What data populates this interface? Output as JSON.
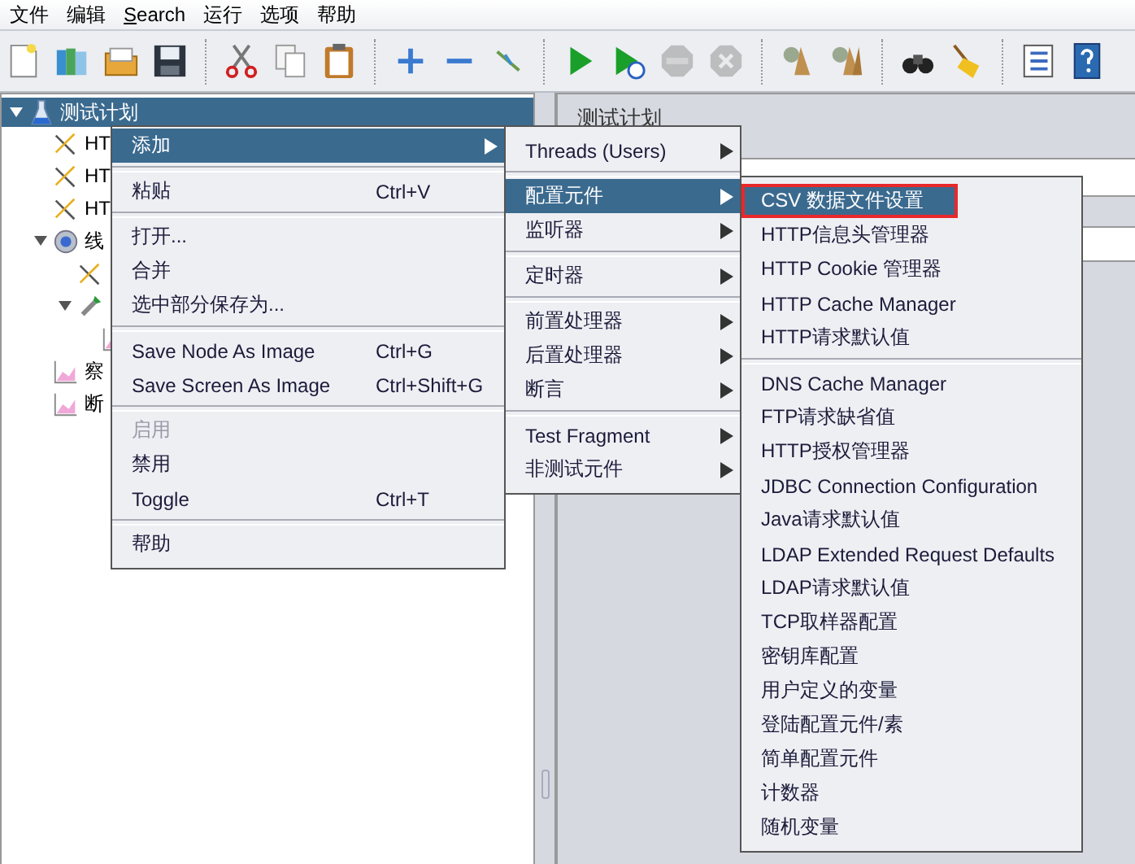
{
  "menubar": [
    {
      "label": "文件",
      "underline_first": false
    },
    {
      "label": "编辑",
      "underline_first": false
    },
    {
      "label": "Search",
      "underline_first": true
    },
    {
      "label": "运行",
      "underline_first": false
    },
    {
      "label": "选项",
      "underline_first": false
    },
    {
      "label": "帮助",
      "underline_first": false
    }
  ],
  "toolbar": [
    [
      {
        "kind": "new",
        "disabled": false
      },
      {
        "kind": "templates",
        "disabled": false
      },
      {
        "kind": "open",
        "disabled": false
      },
      {
        "kind": "save",
        "disabled": false
      }
    ],
    [
      {
        "kind": "cut",
        "disabled": false
      },
      {
        "kind": "copy",
        "disabled": false
      },
      {
        "kind": "paste",
        "disabled": false
      }
    ],
    [
      {
        "kind": "expand",
        "disabled": false
      },
      {
        "kind": "collapse",
        "disabled": false
      },
      {
        "kind": "toggle",
        "disabled": false
      }
    ],
    [
      {
        "kind": "start",
        "disabled": false
      },
      {
        "kind": "start_no_pause",
        "disabled": false
      },
      {
        "kind": "stop",
        "disabled": true
      },
      {
        "kind": "shutdown",
        "disabled": true
      }
    ],
    [
      {
        "kind": "clear",
        "disabled": false
      },
      {
        "kind": "clear_all",
        "disabled": false
      }
    ],
    [
      {
        "kind": "search",
        "disabled": false
      },
      {
        "kind": "reset_search",
        "disabled": false
      }
    ],
    [
      {
        "kind": "function_helper",
        "disabled": false
      },
      {
        "kind": "help",
        "disabled": false
      }
    ]
  ],
  "tree": [
    {
      "label": "测试计划",
      "kind": "flask",
      "selected": true,
      "expanded": true,
      "children": [
        {
          "label": "HT",
          "kind": "tools",
          "selected": false
        },
        {
          "label": "HT",
          "kind": "tools",
          "selected": false
        },
        {
          "label": "HT",
          "kind": "tools",
          "selected": false
        },
        {
          "label": "线",
          "kind": "gear",
          "selected": false,
          "expanded": true,
          "children": [
            {
              "kind": "tools",
              "selected": false
            },
            {
              "kind": "dropper",
              "selected": false,
              "expanded": true,
              "children": [
                {
                  "kind": "graph",
                  "selected": false
                }
              ]
            }
          ]
        },
        {
          "label": "察",
          "kind": "graph",
          "selected": false
        },
        {
          "label": "断",
          "kind": "graph",
          "selected": false
        }
      ]
    }
  ],
  "editor": {
    "title": "测试计划"
  },
  "context_menu": [
    {
      "kind": "item",
      "label": "添加",
      "selected": true,
      "has_submenu": true,
      "disabled": false
    },
    {
      "kind": "separator"
    },
    {
      "kind": "item",
      "label": "粘贴",
      "shortcut": "Ctrl+V",
      "selected": false,
      "has_submenu": false,
      "disabled": false
    },
    {
      "kind": "separator"
    },
    {
      "kind": "item",
      "label": "打开...",
      "selected": false,
      "has_submenu": false,
      "disabled": false
    },
    {
      "kind": "item",
      "label": "合并",
      "selected": false,
      "has_submenu": false,
      "disabled": false
    },
    {
      "kind": "item",
      "label": "选中部分保存为...",
      "selected": false,
      "has_submenu": false,
      "disabled": false
    },
    {
      "kind": "separator"
    },
    {
      "kind": "item",
      "label": "Save Node As Image",
      "shortcut": "Ctrl+G",
      "selected": false,
      "has_submenu": false,
      "disabled": false
    },
    {
      "kind": "item",
      "label": "Save Screen As Image",
      "shortcut": "Ctrl+Shift+G",
      "selected": false,
      "has_submenu": false,
      "disabled": false
    },
    {
      "kind": "separator"
    },
    {
      "kind": "item",
      "label": "启用",
      "selected": false,
      "has_submenu": false,
      "disabled": true
    },
    {
      "kind": "item",
      "label": "禁用",
      "selected": false,
      "has_submenu": false,
      "disabled": false
    },
    {
      "kind": "item",
      "label": "Toggle",
      "shortcut": "Ctrl+T",
      "selected": false,
      "has_submenu": false,
      "disabled": false
    },
    {
      "kind": "separator"
    },
    {
      "kind": "item",
      "label": "帮助",
      "selected": false,
      "has_submenu": false,
      "disabled": false
    }
  ],
  "add_submenu": [
    {
      "kind": "item",
      "label": "Threads (Users)",
      "selected": false,
      "has_submenu": true,
      "disabled": false
    },
    {
      "kind": "separator"
    },
    {
      "kind": "item",
      "label": "配置元件",
      "selected": true,
      "has_submenu": true,
      "disabled": false
    },
    {
      "kind": "item",
      "label": "监听器",
      "selected": false,
      "has_submenu": true,
      "disabled": false
    },
    {
      "kind": "separator"
    },
    {
      "kind": "item",
      "label": "定时器",
      "selected": false,
      "has_submenu": true,
      "disabled": false
    },
    {
      "kind": "separator"
    },
    {
      "kind": "item",
      "label": "前置处理器",
      "selected": false,
      "has_submenu": true,
      "disabled": false
    },
    {
      "kind": "item",
      "label": "后置处理器",
      "selected": false,
      "has_submenu": true,
      "disabled": false
    },
    {
      "kind": "item",
      "label": "断言",
      "selected": false,
      "has_submenu": true,
      "disabled": false
    },
    {
      "kind": "separator"
    },
    {
      "kind": "item",
      "label": "Test Fragment",
      "selected": false,
      "has_submenu": true,
      "disabled": false
    },
    {
      "kind": "item",
      "label": "非测试元件",
      "selected": false,
      "has_submenu": true,
      "disabled": false
    }
  ],
  "config_submenu": [
    {
      "kind": "item",
      "label": "CSV 数据文件设置",
      "selected": true,
      "highlighted": true,
      "has_submenu": false,
      "disabled": false
    },
    {
      "kind": "item",
      "label": "HTTP信息头管理器",
      "selected": false,
      "has_submenu": false,
      "disabled": false
    },
    {
      "kind": "item",
      "label": "HTTP Cookie 管理器",
      "selected": false,
      "has_submenu": false,
      "disabled": false
    },
    {
      "kind": "item",
      "label": "HTTP Cache Manager",
      "selected": false,
      "has_submenu": false,
      "disabled": false
    },
    {
      "kind": "item",
      "label": "HTTP请求默认值",
      "selected": false,
      "has_submenu": false,
      "disabled": false
    },
    {
      "kind": "separator"
    },
    {
      "kind": "item",
      "label": "DNS Cache Manager",
      "selected": false,
      "has_submenu": false,
      "disabled": false
    },
    {
      "kind": "item",
      "label": "FTP请求缺省值",
      "selected": false,
      "has_submenu": false,
      "disabled": false
    },
    {
      "kind": "item",
      "label": "HTTP授权管理器",
      "selected": false,
      "has_submenu": false,
      "disabled": false
    },
    {
      "kind": "item",
      "label": "JDBC Connection Configuration",
      "selected": false,
      "has_submenu": false,
      "disabled": false
    },
    {
      "kind": "item",
      "label": "Java请求默认值",
      "selected": false,
      "has_submenu": false,
      "disabled": false
    },
    {
      "kind": "item",
      "label": "LDAP Extended Request Defaults",
      "selected": false,
      "has_submenu": false,
      "disabled": false
    },
    {
      "kind": "item",
      "label": "LDAP请求默认值",
      "selected": false,
      "has_submenu": false,
      "disabled": false
    },
    {
      "kind": "item",
      "label": "TCP取样器配置",
      "selected": false,
      "has_submenu": false,
      "disabled": false
    },
    {
      "kind": "item",
      "label": "密钥库配置",
      "selected": false,
      "has_submenu": false,
      "disabled": false
    },
    {
      "kind": "item",
      "label": "用户定义的变量",
      "selected": false,
      "has_submenu": false,
      "disabled": false
    },
    {
      "kind": "item",
      "label": "登陆配置元件/素",
      "selected": false,
      "has_submenu": false,
      "disabled": false
    },
    {
      "kind": "item",
      "label": "简单配置元件",
      "selected": false,
      "has_submenu": false,
      "disabled": false
    },
    {
      "kind": "item",
      "label": "计数器",
      "selected": false,
      "has_submenu": false,
      "disabled": false
    },
    {
      "kind": "item",
      "label": "随机变量",
      "selected": false,
      "has_submenu": false,
      "disabled": false
    }
  ]
}
